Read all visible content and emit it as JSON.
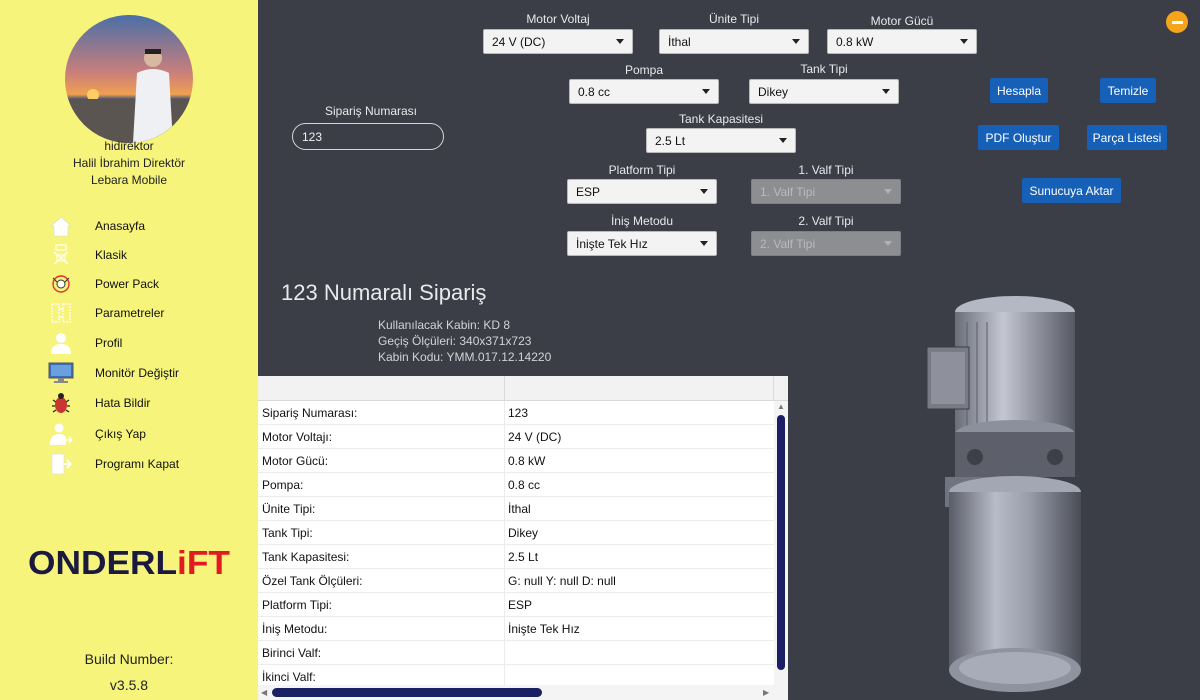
{
  "user": {
    "username": "hidirektor",
    "full_name": "Halil İbrahim Direktör",
    "company": "Lebara Mobile"
  },
  "nav": [
    {
      "label": "Anasayfa",
      "icon": "home-icon"
    },
    {
      "label": "Klasik",
      "icon": "classic-unit-icon"
    },
    {
      "label": "Power Pack",
      "icon": "power-pack-icon"
    },
    {
      "label": "Parametreler",
      "icon": "parameters-icon"
    },
    {
      "label": "Profil",
      "icon": "profile-icon"
    },
    {
      "label": "Monitör Değiştir",
      "icon": "monitor-icon"
    },
    {
      "label": "Hata Bildir",
      "icon": "bug-icon"
    },
    {
      "label": "Çıkış Yap",
      "icon": "logout-icon"
    },
    {
      "label": "Programı Kapat",
      "icon": "exit-app-icon"
    }
  ],
  "brand": {
    "logo_text": "ONDERLIFT",
    "logo_dark": "#1a1a40",
    "logo_red": "#e01b23"
  },
  "build": {
    "label": "Build Number:",
    "version": "v3.5.8"
  },
  "form": {
    "order_number": {
      "label": "Sipariş Numarası",
      "value": "123"
    },
    "motor_voltage": {
      "label": "Motor Voltaj",
      "value": "24 V (DC)"
    },
    "unit_type": {
      "label": "Ünite Tipi",
      "value": "İthal"
    },
    "motor_power": {
      "label": "Motor Gücü",
      "value": "0.8 kW"
    },
    "pump": {
      "label": "Pompa",
      "value": "0.8 cc"
    },
    "tank_type": {
      "label": "Tank Tipi",
      "value": "Dikey"
    },
    "tank_capacity": {
      "label": "Tank Kapasitesi",
      "value": "2.5 Lt"
    },
    "platform_type": {
      "label": "Platform Tipi",
      "value": "ESP"
    },
    "valve1_type": {
      "label": "1. Valf Tipi",
      "value": "1. Valf Tipi"
    },
    "descent_method": {
      "label": "İniş Metodu",
      "value": "İnişte Tek Hız"
    },
    "valve2_type": {
      "label": "2. Valf Tipi",
      "value": "2. Valf Tipi"
    }
  },
  "buttons": {
    "calculate": "Hesapla",
    "clear": "Temizle",
    "create_pdf": "PDF Oluştur",
    "parts_list": "Parça Listesi",
    "upload_server": "Sunucuya Aktar"
  },
  "summary": {
    "title": "123 Numaralı Sipariş",
    "cabin": "Kullanılacak Kabin: KD 8",
    "dimensions": "Geçiş Ölçüleri: 340x371x723",
    "cabin_code": "Kabin Kodu: YMM.017.12.14220"
  },
  "table": {
    "columns": [
      "",
      ""
    ],
    "rows": [
      [
        "Sipariş Numarası:",
        "123"
      ],
      [
        "Motor Voltajı:",
        "24 V (DC)"
      ],
      [
        "Motor Gücü:",
        "0.8 kW"
      ],
      [
        "Pompa:",
        "0.8 cc"
      ],
      [
        "Ünite Tipi:",
        "İthal"
      ],
      [
        "Tank Tipi:",
        "Dikey"
      ],
      [
        "Tank Kapasitesi:",
        "2.5 Lt"
      ],
      [
        "Özel Tank Ölçüleri:",
        "G: null Y: null D: null"
      ],
      [
        "Platform Tipi:",
        "ESP"
      ],
      [
        "İniş Metodu:",
        "İnişte Tek Hız"
      ],
      [
        "Birinci Valf:",
        ""
      ],
      [
        "İkinci Valf:",
        ""
      ]
    ]
  },
  "colors": {
    "sidebar": "#f6f47a",
    "background": "#3b3e46",
    "button": "#1760b8",
    "scroll_thumb": "#1b1f63",
    "minimize": "#f5a41c"
  }
}
